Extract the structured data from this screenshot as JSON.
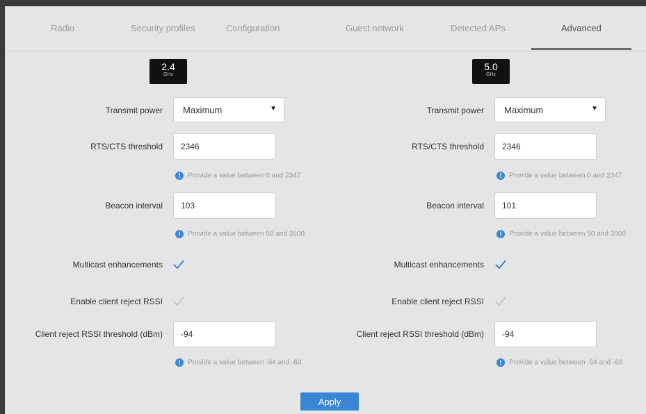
{
  "tabs": [
    {
      "label": "Radio"
    },
    {
      "label": "Security profiles"
    },
    {
      "label": "Configuration"
    },
    {
      "label": "Guest network"
    },
    {
      "label": "Detected APs"
    },
    {
      "label": "Advanced"
    }
  ],
  "active_tab": "Advanced",
  "bands": [
    {
      "band": "2.4",
      "unit": "GHz",
      "transmit_power_label": "Transmit power",
      "transmit_power_value": "Maximum",
      "rts_label": "RTS/CTS threshold",
      "rts_value": "2346",
      "rts_hint": "Provide a value between 0 and 2347",
      "beacon_label": "Beacon interval",
      "beacon_value": "103",
      "beacon_hint": "Provide a value between 50 and 3500",
      "multicast_label": "Multicast enhancements",
      "multicast_checked": true,
      "reject_label": "Enable client reject RSSI",
      "reject_checked": false,
      "rssi_label": "Client reject RSSI threshold (dBm)",
      "rssi_value": "-94",
      "rssi_hint": "Provide a value between -94 and -60"
    },
    {
      "band": "5.0",
      "unit": "GHz",
      "transmit_power_label": "Transmit power",
      "transmit_power_value": "Maximum",
      "rts_label": "RTS/CTS threshold",
      "rts_value": "2346",
      "rts_hint": "Provide a value between 0 and 2347",
      "beacon_label": "Beacon interval",
      "beacon_value": "101",
      "beacon_hint": "Provide a value between 50 and 3500",
      "multicast_label": "Multicast enhancements",
      "multicast_checked": true,
      "reject_label": "Enable client reject RSSI",
      "reject_checked": false,
      "rssi_label": "Client reject RSSI threshold (dBm)",
      "rssi_value": "-94",
      "rssi_hint": "Provide a value between -94 and -60"
    }
  ],
  "apply_label": "Apply",
  "colors": {
    "accent": "#3a86d4",
    "check": "#3b86d6",
    "check_disabled": "#c8c8c8",
    "badge": "#111111"
  }
}
